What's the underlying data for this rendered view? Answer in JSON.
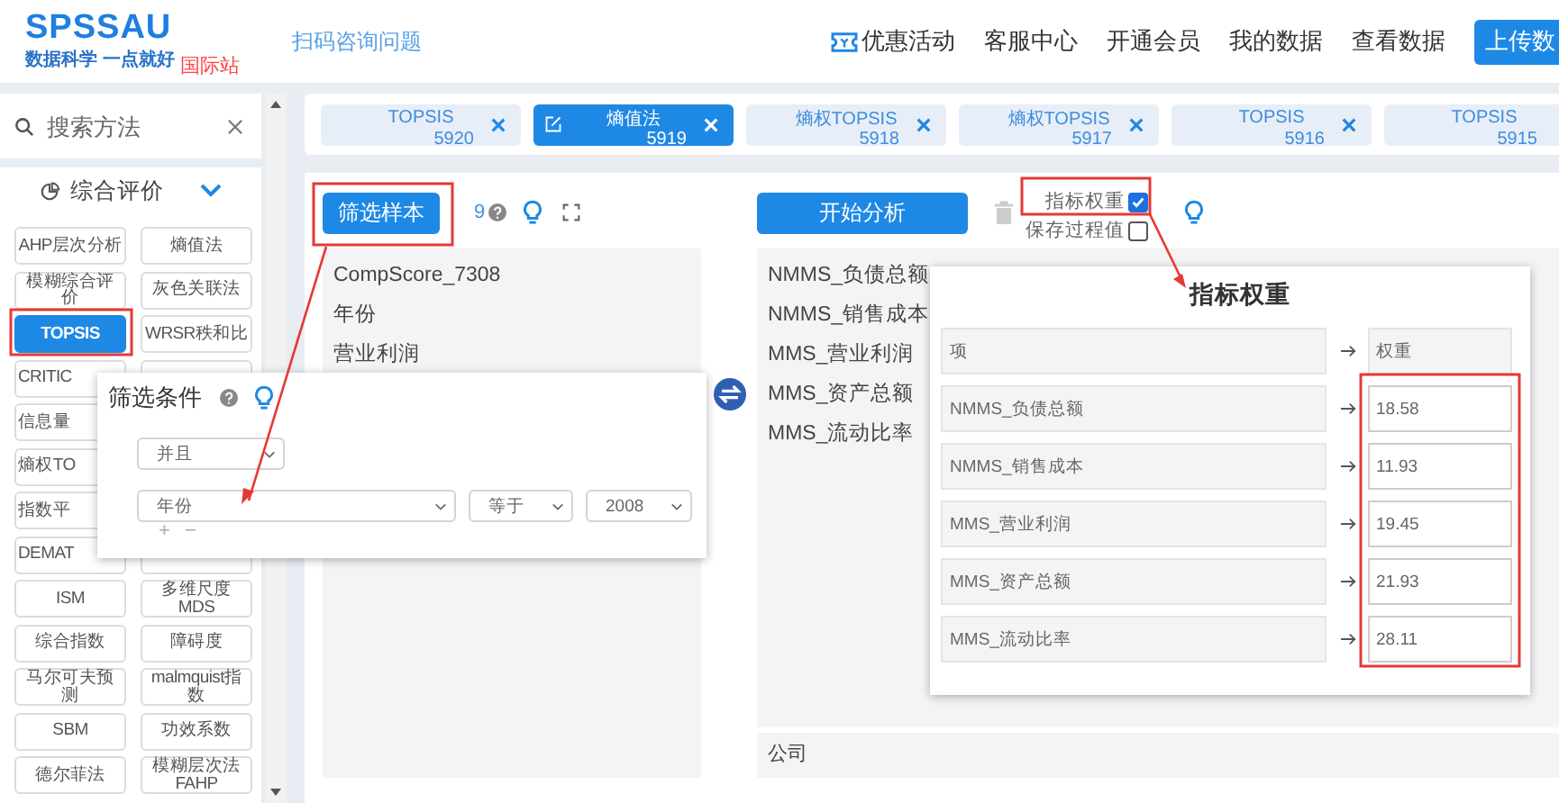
{
  "header": {
    "logo": "SPSSAU",
    "slogan": "数据科学 一点就好",
    "site_badge": "国际站",
    "consult_link": "扫码咨询问题",
    "nav": [
      "优惠活动",
      "客服中心",
      "开通会员",
      "我的数据",
      "查看数据"
    ],
    "upload_button": "上传数"
  },
  "sidebar": {
    "search": {
      "placeholder": "搜索方法"
    },
    "category": {
      "label": "综合评价",
      "expanded": true
    },
    "method_rows": [
      [
        {
          "label": "AHP层次分析",
          "selected": false
        },
        {
          "label": "熵值法",
          "selected": false
        }
      ],
      [
        {
          "label": "模糊综合评价",
          "selected": false
        },
        {
          "label": "灰色关联法",
          "selected": false
        }
      ],
      [
        {
          "label": "TOPSIS",
          "selected": true
        },
        {
          "label": "WRSR秩和比",
          "selected": false
        }
      ],
      [
        {
          "label": "CRITIC",
          "selected": false
        }
      ],
      [
        {
          "label": "信息量",
          "selected": false
        }
      ],
      [
        {
          "label": "熵权TO",
          "selected": false
        }
      ],
      [
        {
          "label": "指数平",
          "selected": false
        }
      ],
      [
        {
          "label": "DEMAT",
          "selected": false
        }
      ],
      [
        {
          "label": "ISM",
          "selected": false
        },
        {
          "label": "多维尺度MDS",
          "selected": false
        }
      ],
      [
        {
          "label": "综合指数",
          "selected": false
        },
        {
          "label": "障碍度",
          "selected": false
        }
      ],
      [
        {
          "label": "马尔可夫预测",
          "selected": false
        },
        {
          "label": "malmquist指数",
          "selected": false
        }
      ],
      [
        {
          "label": "SBM",
          "selected": false
        },
        {
          "label": "功效系数",
          "selected": false
        }
      ],
      [
        {
          "label": "德尔菲法",
          "selected": false
        },
        {
          "label": "模糊层次法FAHP",
          "selected": false
        }
      ]
    ]
  },
  "tabs": [
    {
      "title": "TOPSIS",
      "number": "5920",
      "selected": false,
      "closable": true
    },
    {
      "title": "熵值法",
      "number": "5919",
      "selected": true,
      "closable": true
    },
    {
      "title": "熵权TOPSIS",
      "number": "5918",
      "selected": false,
      "closable": true
    },
    {
      "title": "熵权TOPSIS",
      "number": "5917",
      "selected": false,
      "closable": true
    },
    {
      "title": "TOPSIS",
      "number": "5916",
      "selected": false,
      "closable": true
    },
    {
      "title": "TOPSIS",
      "number": "5915",
      "selected": false,
      "closable": false
    }
  ],
  "sample_panel": {
    "filter_button": "筛选样本",
    "count": "9",
    "variables": [
      "CompScore_7308",
      "年份",
      "营业利润"
    ]
  },
  "analysis_panel": {
    "start_button": "开始分析",
    "options": [
      {
        "label": "指标权重",
        "checked": true
      },
      {
        "label": "保存过程值",
        "checked": false
      }
    ],
    "variables": [
      "NMMS_负债总额",
      "NMMS_销售成本",
      "MMS_营业利润",
      "MMS_资产总额",
      "MMS_流动比率"
    ],
    "bottom_variable": "公司"
  },
  "filter_dialog": {
    "title": "筛选条件",
    "logic_select": "并且",
    "conditions": [
      {
        "field": "年份",
        "operator": "等于",
        "value": "2008"
      }
    ],
    "add": "+",
    "remove": "−"
  },
  "weights_dialog": {
    "title": "指标权重",
    "header": {
      "item": "项",
      "value": "权重"
    },
    "rows": [
      {
        "item": "NMMS_负债总额",
        "value": "18.58"
      },
      {
        "item": "NMMS_销售成本",
        "value": "11.93"
      },
      {
        "item": "MMS_营业利润",
        "value": "19.45"
      },
      {
        "item": "MMS_资产总额",
        "value": "21.93"
      },
      {
        "item": "MMS_流动比率",
        "value": "28.11"
      }
    ]
  }
}
